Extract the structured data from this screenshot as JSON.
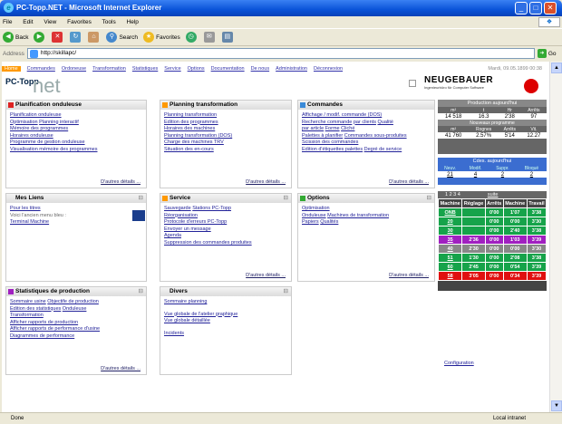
{
  "window": {
    "title": "PC-Topp.NET - Microsoft Internet Explorer"
  },
  "menu": [
    "File",
    "Edit",
    "View",
    "Favorites",
    "Tools",
    "Help"
  ],
  "toolbar": {
    "back": "Back",
    "search": "Search",
    "favorites": "Favorites"
  },
  "address": {
    "label": "Address",
    "url": "http://skillapc/",
    "go": "Go"
  },
  "nav": {
    "items": [
      "Home",
      "Commandes",
      "Ordoneuse",
      "Transformation",
      "Statistiques",
      "Service",
      "Options",
      "Documentation",
      "De nous",
      "Administration",
      "Déconnexion"
    ],
    "date": "Mardi, 09.05.1899 00:38"
  },
  "logo": {
    "pc": "PC-Topp",
    "net": "net"
  },
  "brand": {
    "name": "NEUGEBAUER",
    "sub": "Ingenieurbüro für Computer Software"
  },
  "panels": {
    "planif": {
      "title": "Planification onduleuse",
      "lines": [
        [
          "Planification onduleuse"
        ],
        [
          "Optimisation",
          "Planning interactif"
        ],
        [
          "Mémoire des programmes"
        ],
        [
          "Horaires onduleuse"
        ],
        [
          "Programme de gestion onduleuse"
        ],
        [
          "Visualisation mémoire des programmes"
        ]
      ],
      "more": "D'autres détails ..."
    },
    "planning": {
      "title": "Planning transformation",
      "lines": [
        [
          "Planning transformation"
        ],
        [
          "Edition des programmes"
        ],
        [
          "Horaires des machines"
        ],
        [
          "Planning transformation (DOS)"
        ],
        [
          "Charge des machines TRV"
        ],
        [
          "Situation des en-cours"
        ]
      ],
      "more": "D'autres détails ..."
    },
    "commandes": {
      "title": "Commandes",
      "lines": [
        [
          "Affichage / modif. commande (DOS)"
        ],
        [
          "Recherche commande",
          "par clients",
          "Qualité"
        ],
        [
          "par article",
          "Forme",
          "Cliché"
        ],
        [
          "Palettes à planifier",
          "Commandes sous-produites"
        ],
        [
          "Scission des commandes"
        ],
        [
          "Edition d'étiquettes palettes",
          "Degré de service"
        ]
      ],
      "more": "D'autres détails ..."
    },
    "liens": {
      "title": "Mes Liens",
      "lines": [
        [
          "Pour les titres"
        ],
        [
          "Voici l'ancien menu bleu :"
        ],
        [
          "Terminal Machine"
        ]
      ]
    },
    "service": {
      "title": "Service",
      "lines": [
        [
          "Sauvegarde",
          "Stations PC-Topp"
        ],
        [
          "Réorganisation"
        ],
        [
          "Protocole d'erreurs PC-Topp"
        ],
        [
          "Envoyer un message"
        ],
        [
          "Agenda"
        ],
        [
          "Suppression des commandes produites"
        ]
      ],
      "more": "D'autres détails ..."
    },
    "options": {
      "title": "Options",
      "lines": [
        [
          "Optimisation"
        ],
        [
          "Onduleuse",
          "Machines de transformation"
        ],
        [
          "Papiers",
          "Qualités"
        ]
      ],
      "more": "D'autres détails ..."
    },
    "stats": {
      "title": "Statistiques de production",
      "lines": [
        [
          "Sommaire usine",
          "Objectife de production"
        ],
        [
          "Edition des statistiques",
          "Onduleuse"
        ],
        [
          "Transformation"
        ],
        [
          "Afficher rapports de production"
        ],
        [
          "Afficher rapports de performance d'usine"
        ],
        [
          "Diagrammes de performance"
        ]
      ],
      "more": "D'autres détails ..."
    },
    "divers": {
      "title": "Divers",
      "lines": [
        [
          "Sommaire planning"
        ],
        [
          ""
        ],
        [
          "Vue globale de l'atelier graphique"
        ],
        [
          "Vue globale détaillée"
        ],
        [
          ""
        ],
        [
          "Incidents"
        ]
      ]
    }
  },
  "prod_today": {
    "title": "Production aujourd'hui",
    "hdr1": [
      "m²",
      "t",
      "Hr",
      "Arrêts"
    ],
    "row1": [
      "14 518",
      "16.3",
      "2'38",
      "97"
    ],
    "sub": "Nouveaux programme",
    "hdr2": [
      "m²",
      "Rognes",
      "Arrêts",
      "Vit."
    ],
    "row2": [
      "41 760",
      "2.57%",
      "5'14",
      "12.27"
    ]
  },
  "cdes_today": {
    "title": "Cdes. aujourd'hui",
    "hdr": [
      "Neuv.",
      "Modif.",
      "Suppr.",
      "Bloqué"
    ],
    "row": [
      "21",
      "4",
      "2",
      "2"
    ]
  },
  "machines": {
    "pages": "1 2 3 4",
    "suite": "suite",
    "hdr": [
      "Machine",
      "Réglage",
      "Arrêts",
      "Machine",
      "Travail"
    ],
    "rows": [
      {
        "m": "ONB",
        "v": [
          "0'00",
          "1'07",
          "3'38"
        ],
        "c": "#16a34a"
      },
      {
        "m": "20",
        "v": [
          "0'00",
          "0'00",
          "3'30"
        ],
        "c": "#16a34a"
      },
      {
        "m": "30",
        "v": [
          "0'00",
          "2'40",
          "3'38"
        ],
        "c": "#16a34a"
      },
      {
        "m": "35",
        "v": [
          "2'36",
          "0'00",
          "1'03",
          "3'39"
        ],
        "c": "#a020c0"
      },
      {
        "m": "40",
        "v": [
          "2'30",
          "0'00",
          "0'00",
          "3'30"
        ],
        "c": "#888888"
      },
      {
        "m": "51",
        "v": [
          "1'30",
          "0'00",
          "2'08",
          "3'38"
        ],
        "c": "#16a34a"
      },
      {
        "m": "60",
        "v": [
          "2'45",
          "0'00",
          "0'54",
          "3'39"
        ],
        "c": "#16a34a"
      },
      {
        "m": "58",
        "v": [
          "3'05",
          "0'00",
          "0'34",
          "3'39"
        ],
        "c": "#e01010"
      }
    ]
  },
  "config": "Configuration",
  "status": {
    "left": "Done",
    "zone": "Local intranet"
  }
}
